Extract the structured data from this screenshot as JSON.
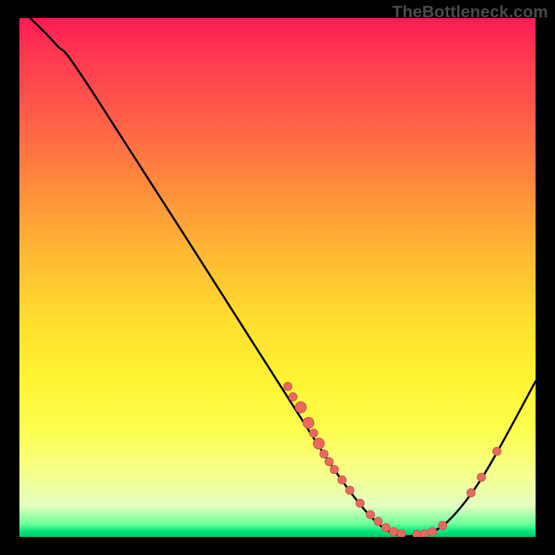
{
  "watermark": "TheBottleneck.com",
  "chart_data": {
    "type": "line",
    "title": "",
    "xlabel": "",
    "ylabel": "",
    "xlim": [
      0,
      100
    ],
    "ylim": [
      0,
      100
    ],
    "curve": [
      {
        "x": 0,
        "y": 102
      },
      {
        "x": 7,
        "y": 95
      },
      {
        "x": 14,
        "y": 86
      },
      {
        "x": 50,
        "y": 30
      },
      {
        "x": 61,
        "y": 13
      },
      {
        "x": 68,
        "y": 4
      },
      {
        "x": 73,
        "y": 0.5
      },
      {
        "x": 78,
        "y": 0.5
      },
      {
        "x": 83,
        "y": 3
      },
      {
        "x": 90,
        "y": 12
      },
      {
        "x": 100,
        "y": 30
      }
    ],
    "dots": [
      {
        "x": 52,
        "y": 29,
        "r": 6
      },
      {
        "x": 53,
        "y": 27,
        "r": 6
      },
      {
        "x": 54.5,
        "y": 25,
        "r": 8
      },
      {
        "x": 56,
        "y": 22,
        "r": 8
      },
      {
        "x": 57,
        "y": 20,
        "r": 6
      },
      {
        "x": 58,
        "y": 18,
        "r": 8
      },
      {
        "x": 59,
        "y": 16,
        "r": 6
      },
      {
        "x": 60,
        "y": 14.5,
        "r": 6
      },
      {
        "x": 61,
        "y": 13,
        "r": 6
      },
      {
        "x": 62.5,
        "y": 11,
        "r": 6
      },
      {
        "x": 64,
        "y": 9,
        "r": 6
      },
      {
        "x": 66,
        "y": 6.5,
        "r": 6
      },
      {
        "x": 68,
        "y": 4.3,
        "r": 6
      },
      {
        "x": 69.5,
        "y": 3,
        "r": 6
      },
      {
        "x": 71,
        "y": 1.8,
        "r": 6
      },
      {
        "x": 72.5,
        "y": 1,
        "r": 6
      },
      {
        "x": 74,
        "y": 0.6,
        "r": 6
      },
      {
        "x": 77,
        "y": 0.5,
        "r": 6
      },
      {
        "x": 78.5,
        "y": 0.6,
        "r": 6
      },
      {
        "x": 80,
        "y": 1.0,
        "r": 6
      },
      {
        "x": 82,
        "y": 2.2,
        "r": 6
      },
      {
        "x": 87.5,
        "y": 8.5,
        "r": 6
      },
      {
        "x": 89.5,
        "y": 11.5,
        "r": 6
      },
      {
        "x": 92.5,
        "y": 16.5,
        "r": 6
      }
    ],
    "colors": {
      "curve": "#000000",
      "dot_fill": "#e9695f",
      "dot_stroke": "#c94f47"
    }
  }
}
